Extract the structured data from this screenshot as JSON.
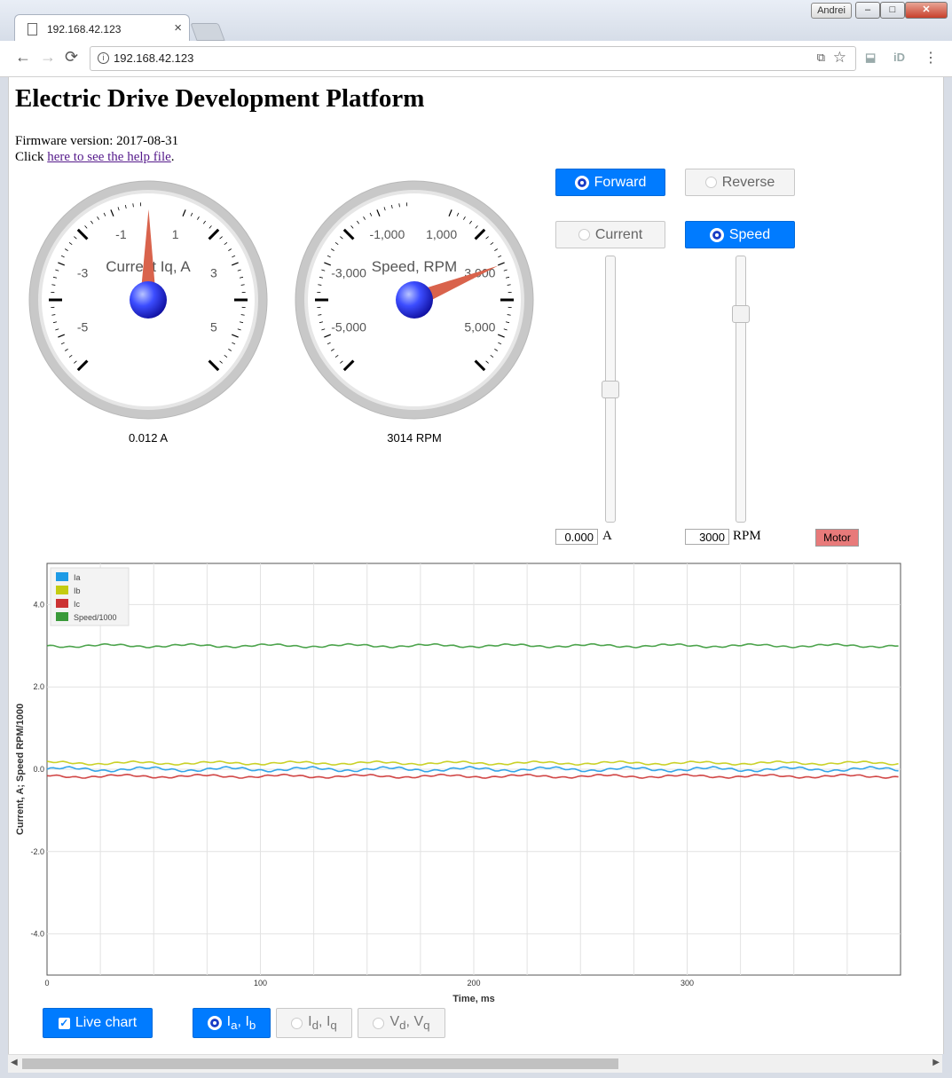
{
  "browser": {
    "tab_title": "192.168.42.123",
    "url": "192.168.42.123",
    "user": "Andrei",
    "ext_id_label": "iD"
  },
  "page": {
    "title": "Electric Drive Development Platform",
    "firmware": "Firmware version: 2017-08-31",
    "help_prefix": "Click ",
    "help_link": "here to see the help file",
    "help_suffix": "."
  },
  "gauges": [
    {
      "title": "Current Iq, A",
      "labels": [
        "-1",
        "1",
        "-3",
        "3",
        "-5",
        "5"
      ],
      "value": 0.012,
      "range": [
        -6,
        6
      ],
      "readout": "0.012 A"
    },
    {
      "title": "Speed, RPM",
      "labels": [
        "-1,000",
        "1,000",
        "-3,000",
        "3,000",
        "-5,000",
        "5,000"
      ],
      "value": 3014,
      "range": [
        -6000,
        6000
      ],
      "readout": "3014 RPM"
    }
  ],
  "controls": {
    "forward": "Forward",
    "reverse": "Reverse",
    "current": "Current",
    "speed": "Speed",
    "current_value": "0.000",
    "current_unit": "A",
    "speed_value": "3000",
    "speed_unit": "RPM",
    "motor": "Motor",
    "current_slider_fraction": 0.5,
    "speed_slider_fraction": 0.2
  },
  "chart_data": {
    "type": "line",
    "xlabel": "Time, ms",
    "ylabel": "Current, A; Speed RPM/1000",
    "xlim": [
      0,
      400
    ],
    "ylim": [
      -5,
      5
    ],
    "xticks": [
      "0",
      "100",
      "200",
      "300"
    ],
    "xtick_values": [
      0,
      100,
      200,
      300
    ],
    "yticks": [
      "4.0",
      "2.0",
      "0.0",
      "-2.0",
      "-4.0"
    ],
    "ytick_values": [
      4,
      2,
      0,
      -2,
      -4
    ],
    "legend_position": "top-left",
    "grid": true,
    "series": [
      {
        "name": "Ia",
        "color": "#1e9be6",
        "value": 0.0,
        "ripple": 0.04
      },
      {
        "name": "Ib",
        "color": "#c4cc11",
        "value": 0.15,
        "ripple": 0.03
      },
      {
        "name": "Ic",
        "color": "#cc3333",
        "value": -0.17,
        "ripple": 0.03
      },
      {
        "name": "Speed/1000",
        "color": "#3a9a3a",
        "value": 3.0,
        "ripple": 0.03
      }
    ]
  },
  "bottom": {
    "live_chart": "Live chart",
    "ab_main": "I",
    "ab_sub1": "a",
    "ab_mid": ", I",
    "ab_sub2": "b",
    "dq_main": "I",
    "dq_sub1": "d",
    "dq_mid": ", I",
    "dq_sub2": "q",
    "v_main": "V",
    "v_sub1": "d",
    "v_mid": ", V",
    "v_sub2": "q"
  }
}
